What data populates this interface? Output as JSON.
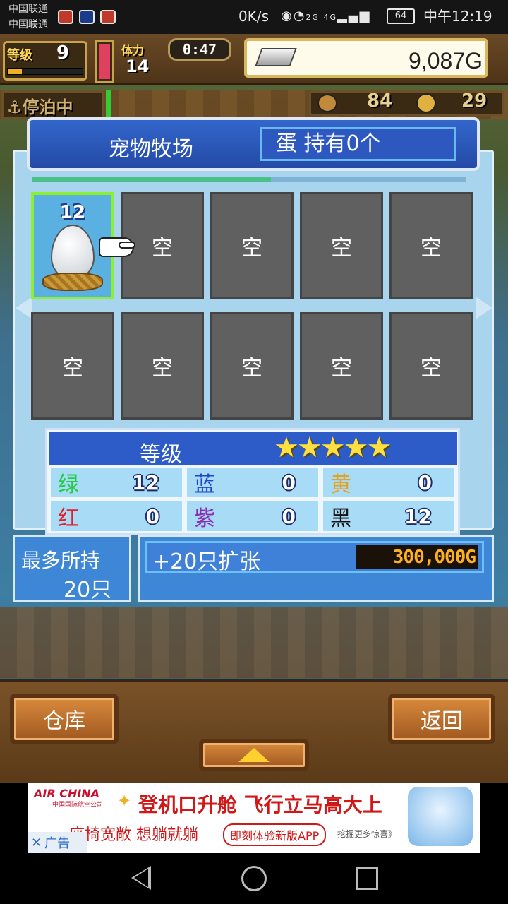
{
  "status_bar": {
    "carrier_1": "中国联通",
    "carrier_2": "中国联通",
    "speed": "0K/s",
    "network": "2G 4G",
    "battery": "64",
    "time": "中午12:19"
  },
  "hud": {
    "level_label": "等级",
    "level_value": "9",
    "stamina_label": "体力",
    "stamina_value": "14",
    "timer": "0:47",
    "gold": "9,087G",
    "docked_status": "停泊中",
    "resource_1": "84",
    "resource_2": "29"
  },
  "panel": {
    "title": "宠物牧场",
    "egg_count": "蛋 持有0个",
    "slots": [
      {
        "label": "12",
        "filled": true
      },
      {
        "label": "空"
      },
      {
        "label": "空"
      },
      {
        "label": "空"
      },
      {
        "label": "空"
      },
      {
        "label": "空"
      },
      {
        "label": "空"
      },
      {
        "label": "空"
      },
      {
        "label": "空"
      },
      {
        "label": "空"
      }
    ],
    "rank": {
      "label": "等级",
      "stars": "★★★★★",
      "star_count": 5,
      "stats": [
        {
          "name": "绿",
          "value": "12",
          "color": "#22cc44"
        },
        {
          "name": "蓝",
          "value": "0",
          "color": "#2244cc"
        },
        {
          "name": "黄",
          "value": "0",
          "color": "#e8a020"
        },
        {
          "name": "红",
          "value": "0",
          "color": "#e02030"
        },
        {
          "name": "紫",
          "value": "0",
          "color": "#8a2ab8"
        },
        {
          "name": "黑",
          "value": "12",
          "color": "#111111"
        }
      ]
    },
    "max_hold_label": "最多所持",
    "max_hold_value": "20只",
    "expand_label": "+20只扩张",
    "expand_price": "300,000G"
  },
  "bottom": {
    "storage_button": "仓库",
    "back_button": "返回"
  },
  "ad": {
    "brand": "AIR CHINA",
    "brand_sub": "中国国际航空公司",
    "headline": "登机口升舱 飞行立马高大上",
    "subline": "座椅宽敞 想躺就躺",
    "cta": "即刻体验新版APP",
    "more": "挖掘更多惊喜》",
    "tag": "广告"
  },
  "colors": {
    "panel_bg": "#a8d4ee",
    "title_bg": "#2d5cc8",
    "empty_slot": "#606060",
    "price_text": "#ffb020"
  }
}
